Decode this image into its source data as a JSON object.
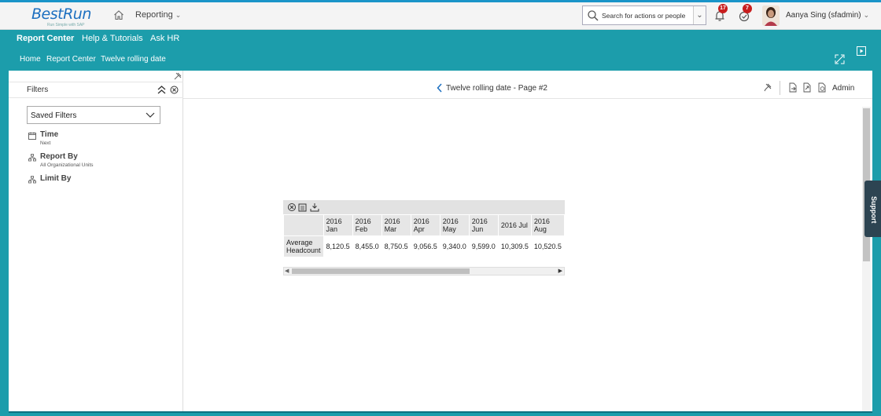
{
  "shell": {
    "logo_text": "BestRun",
    "logo_tagline": "Run Simple with SAP",
    "module_label": "Reporting",
    "search_placeholder": "Search for actions or people",
    "notifications_count": "17",
    "todo_count": "7",
    "user_label": "Aanya Sing (sfadmin)"
  },
  "menubar": {
    "items": [
      "Report Center",
      "Help & Tutorials",
      "Ask HR"
    ],
    "breadcrumbs": [
      "Home",
      "Report Center",
      "Twelve rolling date"
    ]
  },
  "filters": {
    "title": "Filters",
    "saved_filters_label": "Saved Filters",
    "items": [
      {
        "name": "Time",
        "sub": "Next",
        "icon": "calendar-icon"
      },
      {
        "name": "Report By",
        "sub": "All Organizational Units",
        "icon": "org-chart-icon"
      },
      {
        "name": "Limit By",
        "sub": "",
        "icon": "org-chart-icon"
      }
    ]
  },
  "report": {
    "page_title": "Twelve rolling date - Page #2",
    "admin_label": "Admin",
    "row_header": "Average Headcount",
    "columns": [
      "2016 Jan",
      "2016 Feb",
      "2016 Mar",
      "2016 Apr",
      "2016 May",
      "2016 Jun",
      "2016 Jul",
      "2016 Aug"
    ],
    "values": [
      "8,120.5",
      "8,455.0",
      "8,750.5",
      "9,056.5",
      "9,340.0",
      "9,599.0",
      "10,309.5",
      "10,520.5"
    ]
  },
  "support_label": "Support",
  "colors": {
    "teal": "#1c9dab",
    "brand_blue": "#1c6fc0",
    "badge_red": "#c81e1e"
  }
}
